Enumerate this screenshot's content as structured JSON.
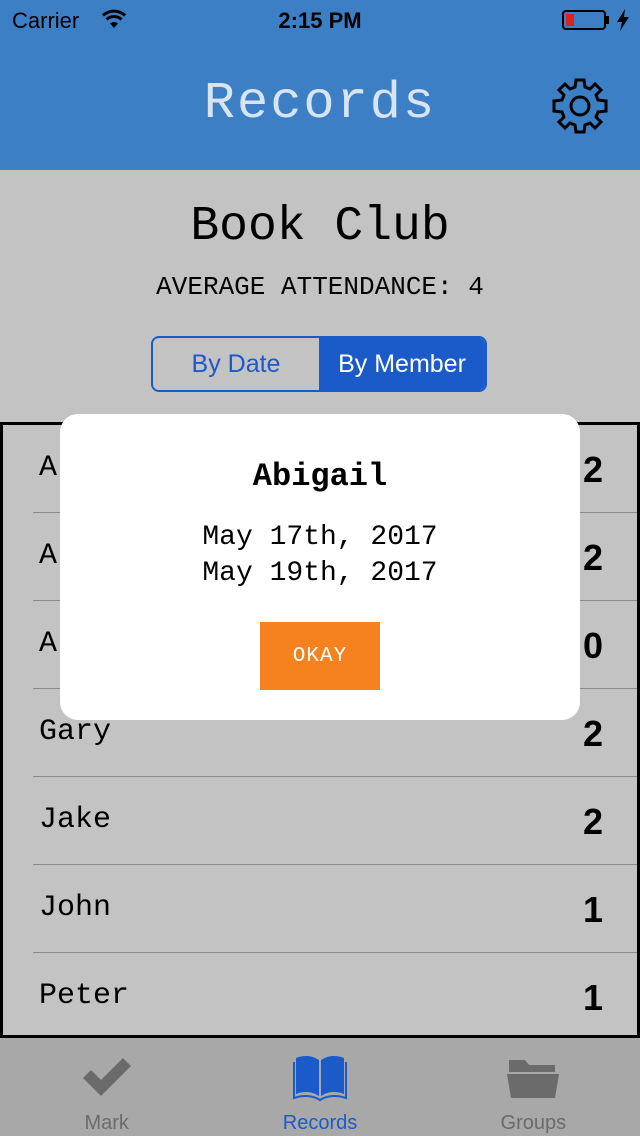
{
  "status": {
    "carrier": "Carrier",
    "time": "2:15 PM"
  },
  "nav": {
    "title": "Records"
  },
  "group": {
    "title": "Book Club",
    "average": "AVERAGE ATTENDANCE: 4"
  },
  "segment": {
    "by_date": "By Date",
    "by_member": "By Member",
    "selected": "By Member"
  },
  "members": [
    {
      "name": "Al",
      "count": "2"
    },
    {
      "name": "A",
      "count": "2"
    },
    {
      "name": "A",
      "count": "0"
    },
    {
      "name": "Gary",
      "count": "2"
    },
    {
      "name": "Jake",
      "count": "2"
    },
    {
      "name": "John",
      "count": "1"
    },
    {
      "name": "Peter",
      "count": "1"
    }
  ],
  "dialog": {
    "title": "Abigail",
    "dates": [
      "May 17th, 2017",
      "May 19th, 2017"
    ],
    "button": "OKAY"
  },
  "tabs": [
    {
      "label": "Mark",
      "icon": "checkmark-icon",
      "active": false
    },
    {
      "label": "Records",
      "icon": "book-icon",
      "active": true
    },
    {
      "label": "Groups",
      "icon": "folder-icon",
      "active": false
    }
  ],
  "colors": {
    "nav_bg": "#3c7fc4",
    "accent": "#1a5bc9",
    "okay_button": "#f5821f",
    "battery_low": "#e0201a"
  }
}
